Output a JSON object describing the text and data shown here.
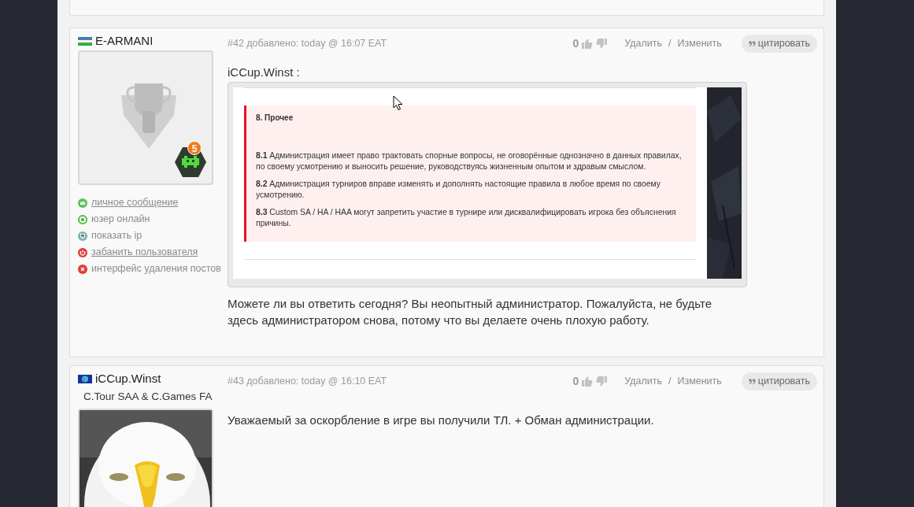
{
  "posts": [
    {
      "author": "E-ARMANI",
      "flag": {
        "kind": "striped"
      },
      "meta": "#42 добавлено: today @ 16:07 EAT",
      "rating": "0",
      "delete": "Удалить",
      "separator": "/",
      "edit": "Изменить",
      "quote": "цитировать",
      "avatar": {
        "kind": "trophy",
        "badge": "5"
      },
      "actions": [
        {
          "kind": "message",
          "label": "личное сообщение",
          "link": true
        },
        {
          "kind": "online",
          "label": "юзер онлайн",
          "link": false
        },
        {
          "kind": "ip",
          "label": "показать ip",
          "link": false
        },
        {
          "kind": "ban",
          "label": "забанить пользователя",
          "link": true
        },
        {
          "kind": "delete",
          "label": "интерфейс удаления постов",
          "link": false
        }
      ],
      "body": [
        {
          "kind": "label",
          "text": "iCCup.Winst :"
        },
        {
          "kind": "screenshot",
          "heading": "8. Прочее",
          "rules": [
            "**8.1** Администрация имеет право трактовать спорные вопросы, не оговорённые однозначно в данных правилах, по своему усмотрению и выносить решение, руководствуясь жизненным опытом и здравым смыслом.",
            "**8.2** Администрация турниров вправе изменять и дополнять настоящие правила в любое время по своему усмотрению.",
            "**8.3** Custom SA / HA / HAA могут запретить участие в турнире или дисквалифицировать игрока без объяснения причины."
          ]
        },
        {
          "kind": "text",
          "text": "Можете ли вы ответить сегодня? Вы неопытный администратор. Пожалуйста, не будьте здесь администратором снова, потому что вы делаете очень плохую работу."
        }
      ]
    },
    {
      "author": "iCCup.Winst",
      "flag": {
        "kind": "globe"
      },
      "user_title": "C.Tour SAA & C.Games FA",
      "meta": "#43 добавлено: today @ 16:10 EAT",
      "rating": "0",
      "delete": "Удалить",
      "separator": "/",
      "edit": "Изменить",
      "quote": "цитировать",
      "avatar": {
        "kind": "picture"
      },
      "body": [
        {
          "kind": "text",
          "text": "Уважаемый за оскорбление в игре вы получили ТЛ. + Обман администрации."
        }
      ]
    }
  ]
}
